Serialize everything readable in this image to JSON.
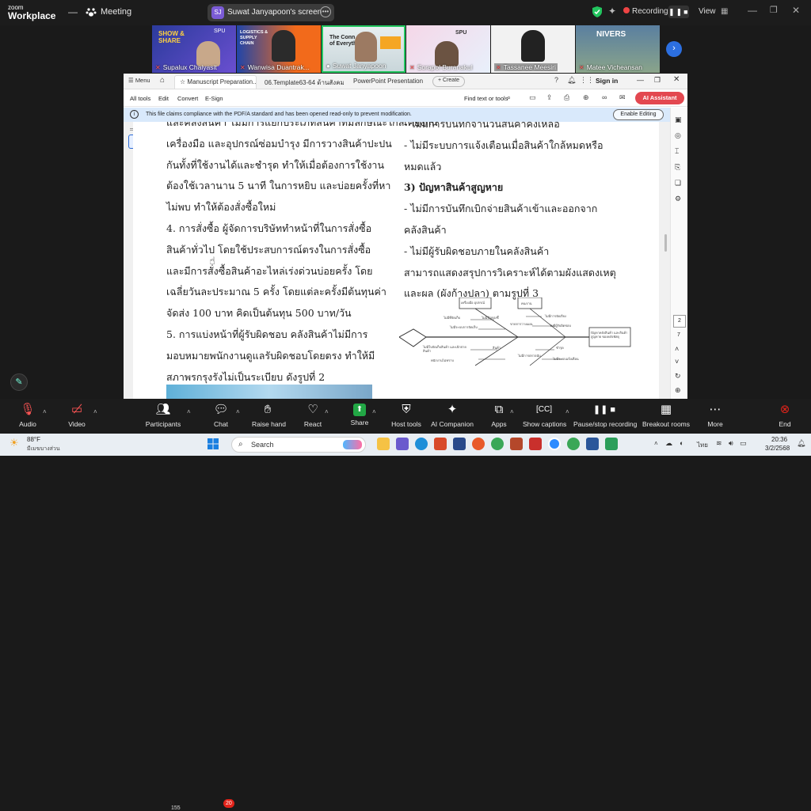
{
  "zoom": {
    "logo_line1": "zoom",
    "logo_line2": "Workplace",
    "meeting_label": "Meeting",
    "screen_share": {
      "avatar": "SJ",
      "label": "Suwat Janyapoon's screen"
    },
    "recording_label": "Recording...",
    "view_label": "View"
  },
  "participants": [
    {
      "name": "Supalux Chaiyasit"
    },
    {
      "name": "Wanwisa Duantrak..."
    },
    {
      "name": "Suwat Janyapoon"
    },
    {
      "name": "Sorapol Buranakul"
    },
    {
      "name": "Tassanee Meesiri"
    },
    {
      "name": "Matee Vicheansan"
    }
  ],
  "tile_texts": {
    "t1_a": "SHOW & SHARE",
    "t1_b": "SPU",
    "t2_a": "LOGISTICS & SUPPLY CHAIN",
    "t3_a": "The Conn of Everyth",
    "t4_a": "SPU",
    "t6_a": "NIVERS"
  },
  "browser": {
    "menu": "Menu",
    "tabs": [
      {
        "label": "Manuscript Preparation..."
      },
      {
        "label": "06.Template63-64 ด้านสังคมศาสตร์..."
      },
      {
        "label": "PowerPoint Presentation"
      }
    ],
    "create": "+ Create",
    "sign_in": "Sign in",
    "toolbar": {
      "all_tools": "All tools",
      "edit": "Edit",
      "convert": "Convert",
      "esign": "E-Sign",
      "find": "Find text or tools",
      "ai": "AI Assistant"
    },
    "info_text": "This file claims compliance with the PDF/A standard and has been opened read-only to prevent modification.",
    "enable_editing": "Enable Editing",
    "page_current": "2",
    "page_total": "7"
  },
  "document": {
    "left_lines": [
      "และคลังสินค้า ไม่มีการแยกประเภทสินค้าที่มีลักษณะใกล้เคียงกัน",
      "เครื่องมือ และอุปกรณ์ซ่อมบำรุง มีการวางสินค้าปะปน",
      "กันทั้งที่ใช้งานได้และชำรุด ทำให้เมื่อต้องการใช้งาน",
      "ต้องใช้เวลานาน 5 นาที ในการหยิบ และบ่อยครั้งที่หา",
      "ไม่พบ ทำให้ต้องสั่งซื้อใหม่",
      "4. การสั่งซื้อ ผู้จัดการบริษัททำหน้าที่ในการสั่งซื้อ",
      "สินค้าทั่วไป โดยใช้ประสบการณ์ตรงในการสั่งซื้อ",
      "และมีการสั่งซื้อสินค้าอะไหล่เร่งด่วนบ่อยครั้ง โดย",
      "เฉลี่ยวันละประมาณ 5 ครั้ง โดยแต่ละครั้งมีต้นทุนค่า",
      "จัดส่ง 100 บาท คิดเป็นต้นทุน 500 บาท/วัน",
      "5. การแบ่งหน้าที่ผู้รับผิดชอบ คลังสินค้าไม่มีการ",
      "มอบหมายพนักงานดูแลรับผิดชอบโดยตรง ทำให้มี",
      "สภาพรกรุงรังไม่เป็นระเบียบ ดังรูปที่ 2"
    ],
    "right_lines": [
      "- ไม่มีการบันทึกจำนวนสินค้าคงเหลือ",
      "- ไม่มีระบบการแจ้งเตือนเมื่อสินค้าใกล้หมดหรือ",
      "หมดแล้ว",
      "3) ปัญหาสินค้าสูญหาย",
      "- ไม่มีการบันทึกเบิกจ่ายสินค้าเข้าและออกจาก",
      "คลังสินค้า",
      "- ไม่มีผู้รับผิดชอบภายในคลังสินค้า",
      "สามารถแสดงสรุปการวิเคราะห์ได้ตามผังแสดงเหตุ",
      "และผล (ผังก้างปลา) ตามรูปที่ 3"
    ],
    "fishbone_labels": {
      "top_left": "เครื่องมือ อุปกรณ์",
      "top_mid": "คน/งาน",
      "head": "ปัญหาคลังสินค้า และสินค้าสูญหาย ของคลังพัสดุ",
      "a1": "ไม่มีที่จัดเก็บ",
      "a2": "ไม่มีป้ายบ่งชี้",
      "a3": "ไม่มีระบบการจัดเก็บ",
      "a4": "ไม่มีการจัดเรียง",
      "a5": "ไม่มีผู้รับผิดชอบ",
      "a6": "ขาดการวางแผน",
      "b1": "ไม่มีใบจัดเก็บสินค้า และเบิกจ่ายสินค้า",
      "b2": "พนักงานไม่ทราบ",
      "b3": "สินค้า",
      "b4": "ไม่มีการตรวจนับ",
      "b5": "ชำรุด",
      "b6": "ไม่มีระบบแจ้งเตือน"
    }
  },
  "toolbar_bottom": {
    "audio": "Audio",
    "video": "Video",
    "participants": "Participants",
    "participants_count": "155",
    "chat": "Chat",
    "chat_badge": "20",
    "raise_hand": "Raise hand",
    "react": "React",
    "share": "Share",
    "host_tools": "Host tools",
    "ai_companion": "AI Companion",
    "apps": "Apps",
    "show_captions": "Show captions",
    "pause_recording": "Pause/stop recording",
    "breakout_rooms": "Breakout rooms",
    "more": "More",
    "end": "End"
  },
  "taskbar": {
    "temp": "88°F",
    "weather_desc": "มีเมฆบางส่วน",
    "search": "Search",
    "lang": "ไทย",
    "time": "20:36",
    "date": "3/2/2568"
  },
  "colors": {
    "zoom_bg": "#1c1c1c",
    "active_speaker": "#22c55e",
    "ai_button": "#e34850",
    "info_bar": "#d9e9fb",
    "end_red": "#e2231a"
  }
}
